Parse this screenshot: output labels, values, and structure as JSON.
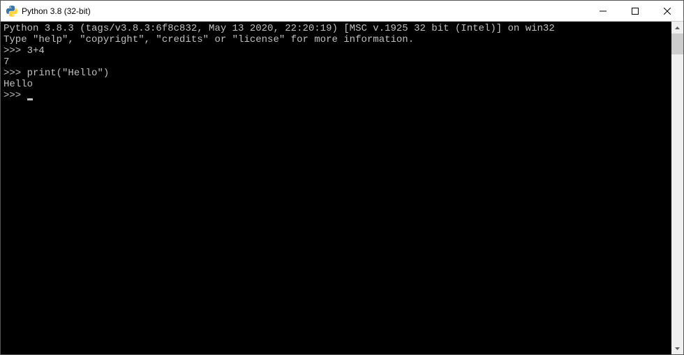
{
  "window": {
    "title": "Python 3.8 (32-bit)"
  },
  "console": {
    "banner_line1": "Python 3.8.3 (tags/v3.8.3:6f8c832, May 13 2020, 22:20:19) [MSC v.1925 32 bit (Intel)] on win32",
    "banner_line2": "Type \"help\", \"copyright\", \"credits\" or \"license\" for more information.",
    "prompt": ">>>",
    "input1": "3+4",
    "output1": "7",
    "input2": "print(\"Hello\")",
    "output2": "Hello"
  }
}
